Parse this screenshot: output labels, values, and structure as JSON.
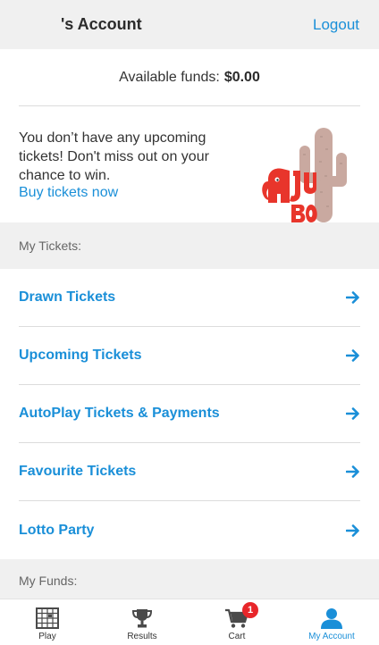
{
  "header": {
    "title": "'s Account",
    "logout_label": "Logout"
  },
  "funds": {
    "label": "Available funds:",
    "amount": "$0.00"
  },
  "promo": {
    "message": "You don’t have any upcoming tickets! Don't miss out on your chance to win.",
    "link_label": "Buy tickets now",
    "illustration_icon": "jumbo-elephant-cactus-logo"
  },
  "my_tickets": {
    "heading": "My Tickets:",
    "items": [
      {
        "label": "Drawn Tickets"
      },
      {
        "label": "Upcoming Tickets"
      },
      {
        "label": "AutoPlay Tickets & Payments"
      },
      {
        "label": "Favourite Tickets"
      },
      {
        "label": "Lotto Party"
      }
    ]
  },
  "my_funds": {
    "heading": "My Funds:"
  },
  "tabbar": {
    "tabs": [
      {
        "label": "Play",
        "icon": "lottery-grid-icon"
      },
      {
        "label": "Results",
        "icon": "trophy-icon"
      },
      {
        "label": "Cart",
        "icon": "cart-icon",
        "badge": "1"
      },
      {
        "label": "My Account",
        "icon": "user-icon",
        "active": true
      }
    ]
  },
  "colors": {
    "accent": "#1a8fd8",
    "badge": "#e8262a",
    "section_bg": "#f0f0f0",
    "logo_red": "#e8352b",
    "cactus": "#c9a9a0"
  }
}
